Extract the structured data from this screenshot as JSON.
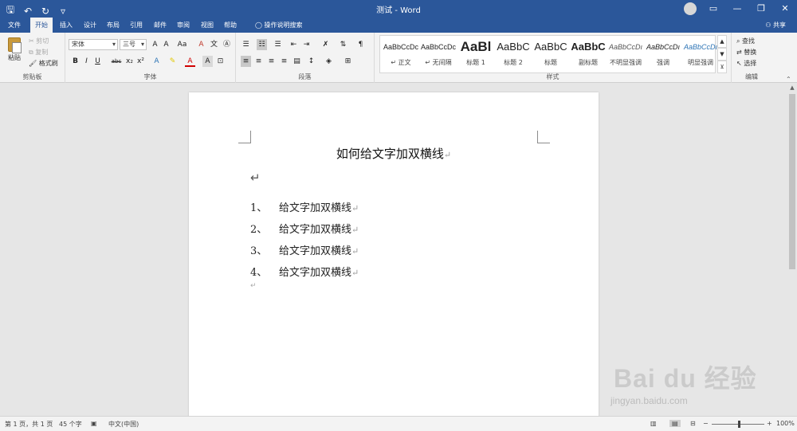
{
  "window": {
    "title": "测试 - Word",
    "qat_icons": [
      "save-icon",
      "undo-icon",
      "redo-icon",
      "customize-icon"
    ],
    "controls": [
      "minimize-icon",
      "restore-icon",
      "close-icon"
    ]
  },
  "tabs": [
    {
      "label": "文件"
    },
    {
      "label": "开始"
    },
    {
      "label": "插入"
    },
    {
      "label": "设计"
    },
    {
      "label": "布局"
    },
    {
      "label": "引用"
    },
    {
      "label": "邮件"
    },
    {
      "label": "审阅"
    },
    {
      "label": "视图"
    },
    {
      "label": "帮助"
    },
    {
      "label": "操作说明搜索"
    }
  ],
  "share_label": "共享",
  "ribbon": {
    "clipboard": {
      "paste": "粘贴",
      "cut": "剪切",
      "copy": "复制",
      "format_painter": "格式刷",
      "group_label": "剪贴板"
    },
    "font": {
      "font_name": "宋体",
      "font_size": "三号",
      "group_label": "字体",
      "buttons": [
        "B",
        "I",
        "U",
        "abc",
        "x₂",
        "x²",
        "A",
        "A"
      ]
    },
    "paragraph": {
      "group_label": "段落"
    },
    "styles": {
      "group_label": "样式",
      "items": [
        {
          "sample": "AaBbCcDc",
          "name": "↵ 正文"
        },
        {
          "sample": "AaBbCcDc",
          "name": "↵ 无间隔"
        },
        {
          "sample": "AaBl",
          "name": "标题 1"
        },
        {
          "sample": "AaBbC",
          "name": "标题 2"
        },
        {
          "sample": "AaBbC",
          "name": "标题"
        },
        {
          "sample": "AaBbC",
          "name": "副标题"
        },
        {
          "sample": "AaBbCcDı",
          "name": "不明显强调"
        },
        {
          "sample": "AaBbCcDı",
          "name": "强调"
        },
        {
          "sample": "AaBbCcDı",
          "name": "明显强调"
        }
      ]
    },
    "editing": {
      "find": "查找",
      "replace": "替换",
      "select": "选择",
      "group_label": "编辑"
    }
  },
  "document": {
    "heading": "如何给文字加双横线",
    "list": [
      {
        "num": "1、",
        "text": "给文字加双横线"
      },
      {
        "num": "2、",
        "text": "给文字加双横线"
      },
      {
        "num": "3、",
        "text": "给文字加双横线"
      },
      {
        "num": "4、",
        "text": "给文字加双横线"
      }
    ],
    "paragraph_mark": "↵"
  },
  "status": {
    "page": "第 1 页，共 1 页",
    "words": "45 个字",
    "language": "中文(中国)",
    "zoom": "100%"
  },
  "watermark": {
    "logo": "Bai du 经验",
    "url": "jingyan.baidu.com"
  }
}
